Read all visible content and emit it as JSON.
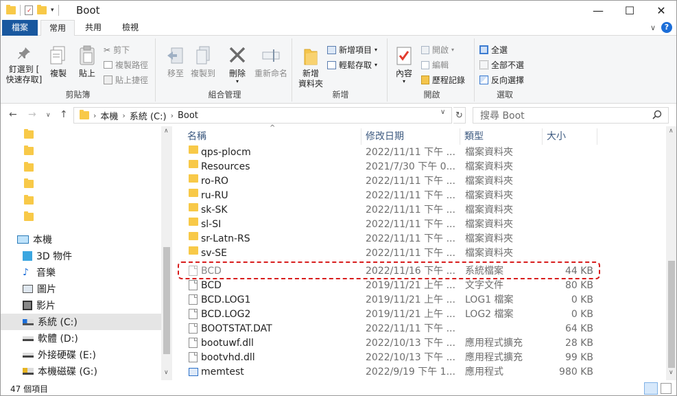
{
  "window": {
    "title": "Boot",
    "minimize": "—",
    "maximize": "☐",
    "close": "✕"
  },
  "tabs": {
    "file": "檔案",
    "home": "常用",
    "share": "共用",
    "view": "檢視"
  },
  "ribbon": {
    "clipboard": {
      "label": "剪貼簿",
      "pin": "釘選到 [\n快速存取]",
      "copy": "複製",
      "paste": "貼上",
      "cut": "剪下",
      "copy_path": "複製路徑",
      "paste_shortcut": "貼上捷徑"
    },
    "organize": {
      "label": "組合管理",
      "move_to": "移至",
      "copy_to": "複製到",
      "delete": "刪除",
      "rename": "重新命名"
    },
    "new": {
      "label": "新增",
      "new_folder": "新增\n資料夾",
      "new_item": "新增項目",
      "easy_access": "輕鬆存取"
    },
    "open": {
      "label": "開啟",
      "properties": "內容",
      "open": "開啟",
      "edit": "編輯",
      "history": "歷程記錄"
    },
    "select": {
      "label": "選取",
      "select_all": "全選",
      "select_none": "全部不選",
      "invert": "反向選擇"
    }
  },
  "address": {
    "crumbs": [
      "本機",
      "系統 (C:)",
      "Boot"
    ]
  },
  "search": {
    "placeholder": "搜尋 Boot"
  },
  "nav": {
    "items": [
      "本機",
      "3D 物件",
      "音樂",
      "圖片",
      "影片",
      "系統 (C:)",
      "軟體 (D:)",
      "外接硬碟 (E:)",
      "本機磁碟 (G:)"
    ],
    "selected": "系統 (C:)"
  },
  "columns": {
    "name": "名稱",
    "date": "修改日期",
    "type": "類型",
    "size": "大小"
  },
  "files": [
    {
      "name": "qps-ploc​m",
      "date": "2022/11/11 下午 ...",
      "type": "檔案資料夾",
      "size": "",
      "kind": "folder"
    },
    {
      "name": "Resources",
      "date": "2021/7/30 下午 0...",
      "type": "檔案資料夾",
      "size": "",
      "kind": "folder"
    },
    {
      "name": "ro-RO",
      "date": "2022/11/11 下午 ...",
      "type": "檔案資料夾",
      "size": "",
      "kind": "folder"
    },
    {
      "name": "ru-RU",
      "date": "2022/11/11 下午 ...",
      "type": "檔案資料夾",
      "size": "",
      "kind": "folder"
    },
    {
      "name": "sk-SK",
      "date": "2022/11/11 下午 ...",
      "type": "檔案資料夾",
      "size": "",
      "kind": "folder"
    },
    {
      "name": "sl-SI",
      "date": "2022/11/11 下午 ...",
      "type": "檔案資料夾",
      "size": "",
      "kind": "folder"
    },
    {
      "name": "sr-Latn-RS",
      "date": "2022/11/11 下午 ...",
      "type": "檔案資料夾",
      "size": "",
      "kind": "folder"
    },
    {
      "name": "sv-SE",
      "date": "2022/11/11 下午 ...",
      "type": "檔案資料夾",
      "size": "",
      "kind": "folder"
    },
    {
      "name": "BCD",
      "date": "2022/11/16 下午 ...",
      "type": "系統檔案",
      "size": "44 KB",
      "kind": "sysfile"
    },
    {
      "name": "BCD",
      "date": "2019/11/21 上午 ...",
      "type": "文字文件",
      "size": "80 KB",
      "kind": "file"
    },
    {
      "name": "BCD.LOG1",
      "date": "2019/11/21 上午 ...",
      "type": "LOG1 檔案",
      "size": "0 KB",
      "kind": "file"
    },
    {
      "name": "BCD.LOG2",
      "date": "2019/11/21 上午 ...",
      "type": "LOG2 檔案",
      "size": "0 KB",
      "kind": "file"
    },
    {
      "name": "BOOTSTAT.DAT",
      "date": "2022/11/11 下午 ...",
      "type": "",
      "size": "64 KB",
      "kind": "file"
    },
    {
      "name": "bootuwf.dll",
      "date": "2022/10/13 下午 ...",
      "type": "應用程式擴充",
      "size": "28 KB",
      "kind": "dll"
    },
    {
      "name": "bootvhd.dll",
      "date": "2022/10/13 下午 ...",
      "type": "應用程式擴充",
      "size": "99 KB",
      "kind": "dll"
    },
    {
      "name": "memtest",
      "date": "2022/9/19 下午 1...",
      "type": "應用程式",
      "size": "980 KB",
      "kind": "exe"
    }
  ],
  "status": {
    "count": "47 個項目"
  }
}
